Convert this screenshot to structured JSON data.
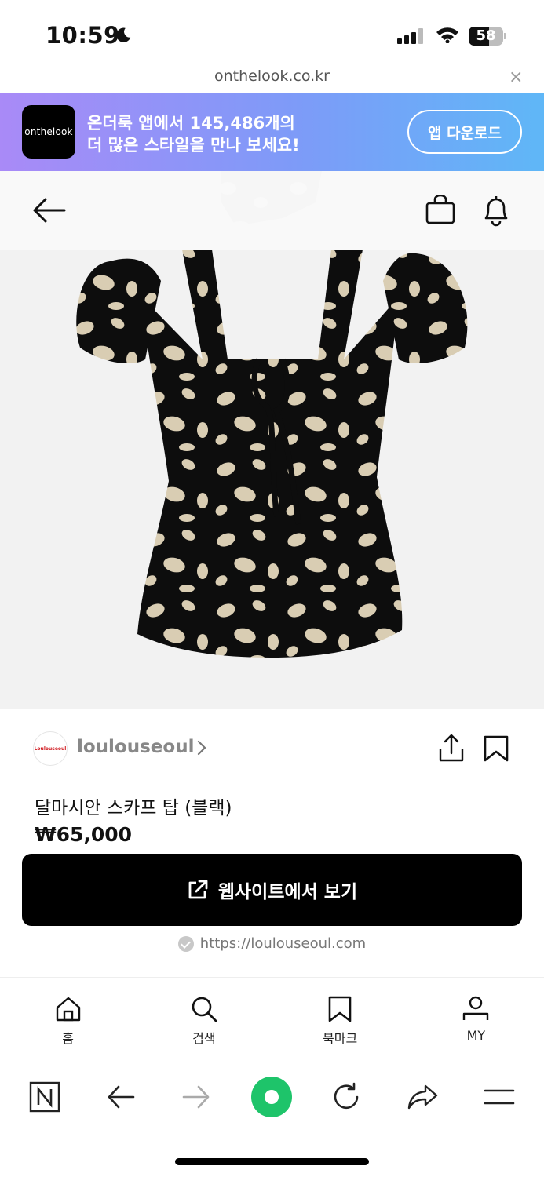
{
  "status_bar": {
    "time": "10:59",
    "battery_level": "58",
    "battery_fraction": 0.58
  },
  "url_bar": {
    "domain": "onthelook.co.kr",
    "close": "×"
  },
  "banner": {
    "logo_text": "onthelook",
    "line1": "온더룩 앱에서 145,486개의",
    "line2": "더 많은 스타일을 만나 보세요!",
    "button_label": "앱 다운로드"
  },
  "product": {
    "brand_logo_text": "Loulouseoul",
    "brand_name": "loulouseoul",
    "title": "달마시안 스카프 탑 (블랙)",
    "price": "₩65,000",
    "visit_button_label": "웹사이트에서 보기",
    "site_url": "https://loulouseoul.com"
  },
  "app_nav": {
    "items": [
      {
        "label": "홈",
        "icon": "home-icon"
      },
      {
        "label": "검색",
        "icon": "search-icon"
      },
      {
        "label": "북마크",
        "icon": "bookmark-icon"
      },
      {
        "label": "MY",
        "icon": "user-icon"
      }
    ]
  },
  "browser_toolbar": {
    "items": [
      "naver-n-icon",
      "back-arrow-icon",
      "forward-arrow-icon",
      "green-dot-icon",
      "reload-icon",
      "share-arrow-icon",
      "menu-icon"
    ]
  },
  "colors": {
    "banner_start": "#a98af7",
    "banner_end": "#5fb7f7",
    "accent_green": "#1ec46a",
    "button_black": "#000000"
  }
}
